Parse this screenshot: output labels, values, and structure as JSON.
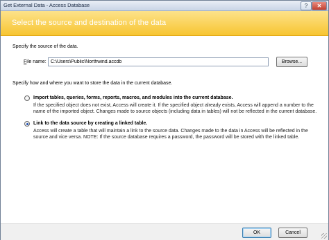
{
  "window": {
    "title": "Get External Data - Access Database"
  },
  "titlebar_buttons": {
    "help_label": "?",
    "close_label": "✕"
  },
  "banner": {
    "text": "Select the source and destination of the data"
  },
  "source": {
    "instruction": "Specify the source of the data.",
    "file_label_accel": "F",
    "file_label_rest": "ile name:",
    "file_value": "C:\\Users\\Public\\Northwind.accdb",
    "browse_label": "Browse..."
  },
  "destination": {
    "instruction": "Specify how and where you want to store the data in the current database.",
    "options": [
      {
        "title": "Import tables, queries, forms, reports, macros, and modules into the current database.",
        "desc1": "If the specified object does not exist, Access will create it. If the specified object already exists, Access will append a number to the",
        "desc2": "name of the imported object. Changes made to source objects (including data in tables) will not be reflected in the current database.",
        "selected": false
      },
      {
        "title": "Link to the data source by creating a linked table.",
        "desc1": "Access will create a table that will maintain a link to the source data. Changes made to the data in Access will be reflected in the",
        "desc2": "source and vice versa. NOTE:  If the source database requires a password, the password will be stored with the linked table.",
        "selected": true
      }
    ]
  },
  "footer": {
    "ok_label": "OK",
    "cancel_label": "Cancel"
  }
}
